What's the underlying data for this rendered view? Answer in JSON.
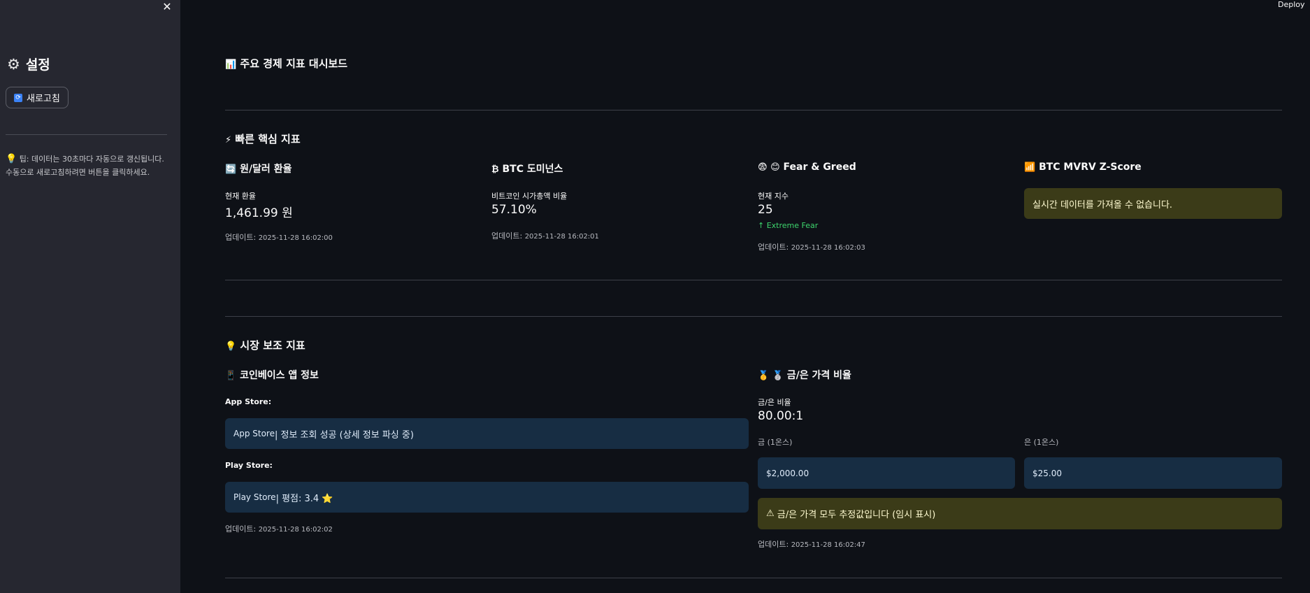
{
  "sidebar": {
    "close_icon": "✕",
    "title": "설정",
    "gear_icon": "⚙",
    "refresh_label": "새로고침",
    "refresh_icon": "🔄",
    "tip_icon": "💡",
    "tip_line1": "팁: 데이터는 30초마다 자동으로 갱신됩니다.",
    "tip_line2": "수동으로 새로고침하려면 버튼을 클릭하세요."
  },
  "header": {
    "deploy_label": "Deploy"
  },
  "page": {
    "title_icon": "📊",
    "title": "주요 경제 지표 대시보드"
  },
  "quick": {
    "heading_icon": "⚡",
    "heading": "빠른 핵심 지표",
    "fx": {
      "icon": "🔄",
      "title": "원/달러 환율",
      "label": "현재 환율",
      "value": "1,461.99 원",
      "updated_prefix": "업데이트:",
      "updated_ts": "2025-11-28 16:02:00"
    },
    "btc_dom": {
      "icon": "₿",
      "title": "BTC 도미넌스",
      "label": "비트코인 시가총액 비율",
      "value": "57.10%",
      "updated_prefix": "업데이트:",
      "updated_ts": "2025-11-28 16:02:01"
    },
    "fng": {
      "icon": "😨 😊",
      "title": "Fear & Greed",
      "label": "현재 지수",
      "value": "25",
      "delta_arrow": "↑",
      "delta": "Extreme Fear",
      "updated_prefix": "업데이트:",
      "updated_ts": "2025-11-28 16:02:03"
    },
    "mvrv": {
      "icon": "📶",
      "title": "BTC MVRV Z-Score",
      "warning": "실시간 데이터를 가져올 수 없습니다."
    }
  },
  "secondary": {
    "heading_icon": "💡",
    "heading": "시장 보조 지표",
    "coinbase": {
      "icon": "📱",
      "title": "코인베이스 앱 정보",
      "appstore_label": "App Store:",
      "appstore_prefix": "App Store",
      "appstore_text": " | 정보 조회 성공 (상세 정보 파싱 중)",
      "playstore_label": "Play Store:",
      "playstore_prefix": "Play Store",
      "playstore_text": " | 평점: 3.4 ⭐",
      "updated_prefix": "업데이트:",
      "updated_ts": "2025-11-28 16:02:02"
    },
    "gold_silver": {
      "icon": "🥇 🥈",
      "title": "금/은 가격 비율",
      "ratio_label": "금/은 비율",
      "ratio_value": "80.00:1",
      "gold_label": "금 (1온스)",
      "gold_value": "$2,000.00",
      "silver_label": "은 (1온스)",
      "silver_value": "$25.00",
      "warning_icon": "⚠",
      "warning": "금/은 가격 모두 추정값입니다 (임시 표시)",
      "updated_prefix": "업데이트:",
      "updated_ts": "2025-11-28 16:02:47"
    }
  },
  "colors": {
    "background": "#0e1117",
    "sidebar": "#262730",
    "warning_bg": "#3b3b18",
    "info_bg": "#172d43",
    "delta_green": "#3dd56d"
  }
}
